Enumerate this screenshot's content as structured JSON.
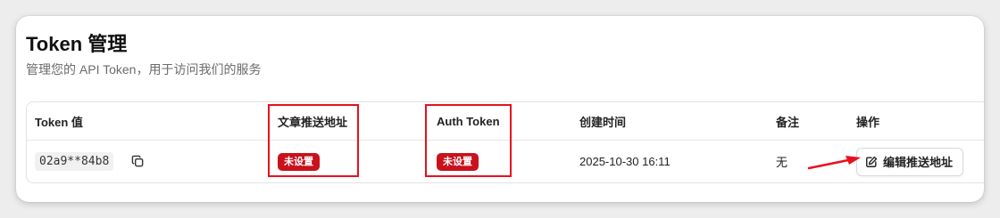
{
  "page": {
    "title": "Token 管理",
    "subtitle": "管理您的 API Token，用于访问我们的服务"
  },
  "table": {
    "headers": {
      "token": "Token 值",
      "push_url": "文章推送地址",
      "auth_token": "Auth Token",
      "created": "创建时间",
      "note": "备注",
      "actions": "操作"
    },
    "rows": [
      {
        "token": "02a9**84b8",
        "push_url_status": "未设置",
        "auth_token_status": "未设置",
        "created": "2025-10-30 16:11",
        "note": "无",
        "edit_label": "编辑推送地址"
      }
    ]
  },
  "icons": {
    "copy": "copy-icon",
    "edit": "edit-icon"
  },
  "colors": {
    "badge_bg": "#c8121c",
    "annotation_red": "#e8101e"
  }
}
